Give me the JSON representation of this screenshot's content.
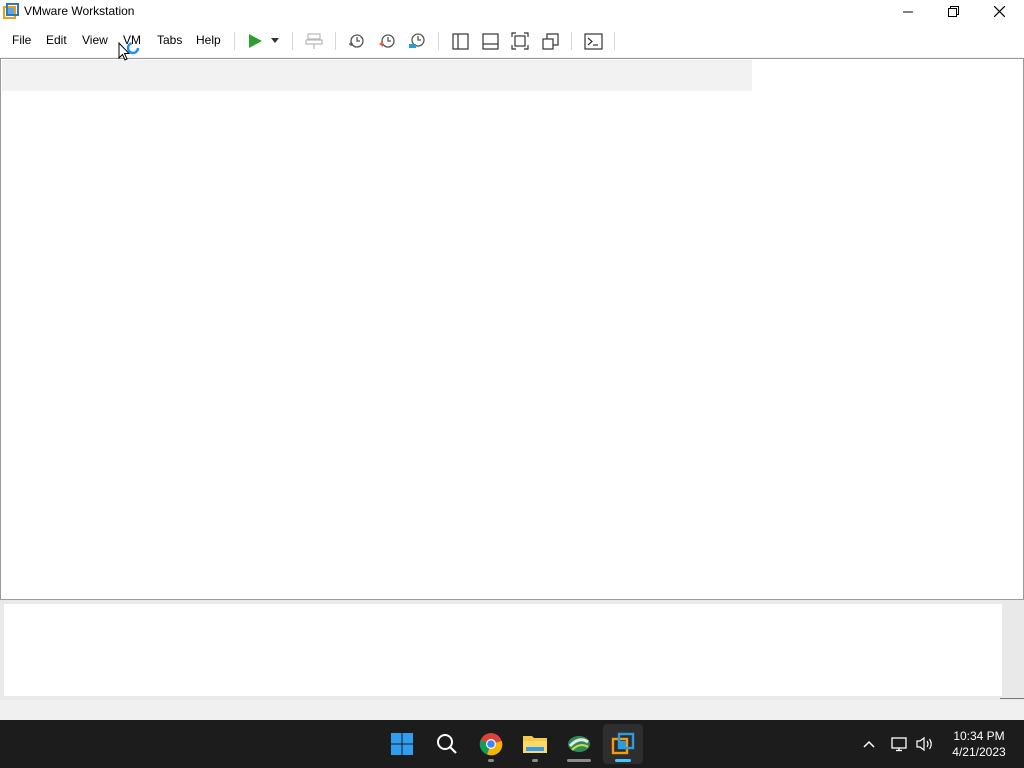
{
  "window": {
    "title": "VMware Workstation",
    "app_icon": "vmware-icon"
  },
  "menu": {
    "items": [
      "File",
      "Edit",
      "View",
      "VM",
      "Tabs",
      "Help"
    ]
  },
  "toolbar": {
    "icons": [
      "power-on-icon",
      "dropdown-arrow-icon",
      "send-ctrl-alt-del-icon",
      "take-snapshot-icon",
      "revert-snapshot-icon",
      "snapshot-manager-icon",
      "show-library-icon",
      "show-thumbnail-bar-icon",
      "full-screen-icon",
      "unity-icon",
      "console-view-icon"
    ]
  },
  "taskbar": {
    "apps": [
      "windows-start-icon",
      "search-icon",
      "chrome-icon",
      "file-explorer-icon",
      "network-app-icon",
      "vmware-icon"
    ],
    "tray": [
      "chevron-up-icon",
      "network-icon",
      "volume-icon"
    ],
    "clock": {
      "time": "10:34 PM",
      "date": "4/21/2023"
    }
  },
  "colors": {
    "accent_green": "#2e9e2e",
    "taskbar_bg": "#1c1c1c",
    "active_indicator": "#4cc2ff"
  }
}
